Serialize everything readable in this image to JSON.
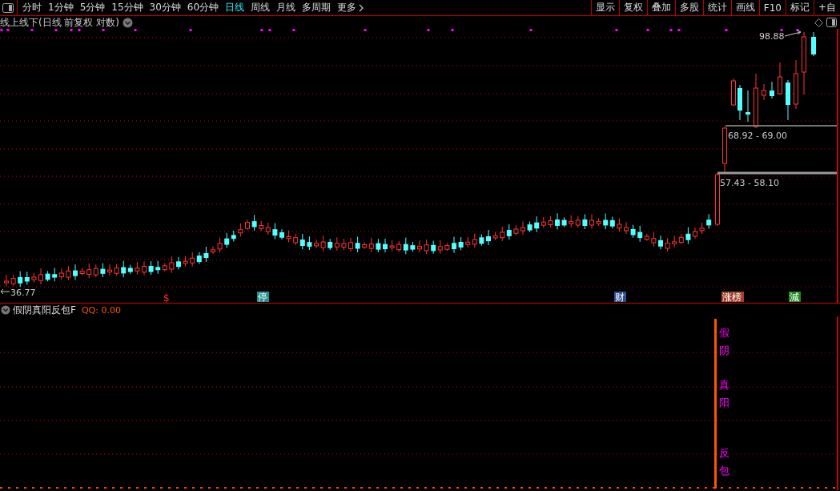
{
  "toolbar": {
    "periods": [
      {
        "label": "分时",
        "selected": false
      },
      {
        "label": "1分钟",
        "selected": false
      },
      {
        "label": "5分钟",
        "selected": false
      },
      {
        "label": "15分钟",
        "selected": false
      },
      {
        "label": "30分钟",
        "selected": false
      },
      {
        "label": "60分钟",
        "selected": false
      },
      {
        "label": "日线",
        "selected": true
      },
      {
        "label": "周线",
        "selected": false
      },
      {
        "label": "月线",
        "selected": false
      },
      {
        "label": "多周期",
        "selected": false
      },
      {
        "label": "更多",
        "selected": false
      }
    ],
    "tools": [
      "显示",
      "复权",
      "叠加",
      "多股",
      "统计",
      "画线",
      "F10",
      "标记",
      "+自"
    ]
  },
  "chart": {
    "title": "线上线下(日线 前复权 对数)",
    "low_label": "36.77",
    "high_label": "98.88",
    "ranges": [
      "68.92 - 69.00",
      "57.43 - 58.10"
    ],
    "events": [
      {
        "label": "$",
        "kind": "text",
        "color": "#ff2a2a"
      },
      {
        "label": "停",
        "kind": "tag",
        "color": "#1f8f8f"
      },
      {
        "label": "财",
        "kind": "tag",
        "color": "#2a4f8f"
      },
      {
        "label": "涨榜",
        "kind": "tag",
        "color": "#a0402a"
      },
      {
        "label": "減",
        "kind": "tag",
        "color": "#1f8a1f"
      }
    ]
  },
  "indicator": {
    "name": "假阴真阳反包F",
    "readout": "QQ: 0.00",
    "signals": [
      "假阴",
      "真阳",
      "反包"
    ]
  }
}
